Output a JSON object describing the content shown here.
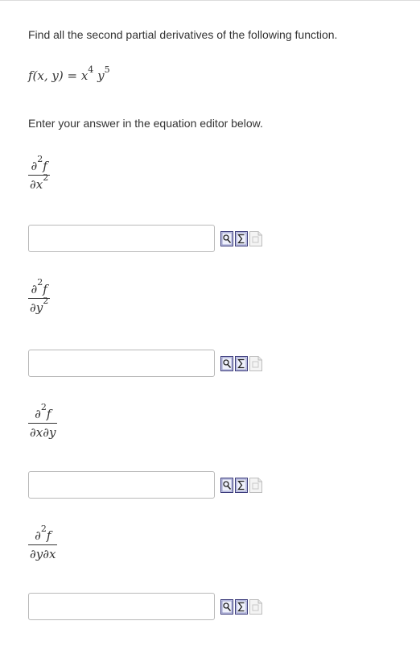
{
  "question": {
    "prompt": "Find all the second partial derivatives of the following function.",
    "function": {
      "lhs": "f(x, y) = x",
      "x_exp": "4",
      "y": "y",
      "y_exp": "5"
    },
    "instruction": "Enter your answer in the equation editor below."
  },
  "parts": [
    {
      "numerator": "∂",
      "num_exp": "2",
      "num_tail": "f",
      "denominator": "∂x",
      "den_exp": "2",
      "den_tail": "",
      "answer": ""
    },
    {
      "numerator": "∂",
      "num_exp": "2",
      "num_tail": "f",
      "denominator": "∂y",
      "den_exp": "2",
      "den_tail": "",
      "answer": ""
    },
    {
      "numerator": "∂",
      "num_exp": "2",
      "num_tail": "f",
      "denominator": "∂x∂y",
      "den_exp": "",
      "den_tail": "",
      "answer": ""
    },
    {
      "numerator": "∂",
      "num_exp": "2",
      "num_tail": "f",
      "denominator": "∂y∂x",
      "den_exp": "",
      "den_tail": "",
      "answer": ""
    }
  ],
  "tool_icons": [
    "preview-icon",
    "equation-editor-icon",
    "help-page-icon"
  ]
}
